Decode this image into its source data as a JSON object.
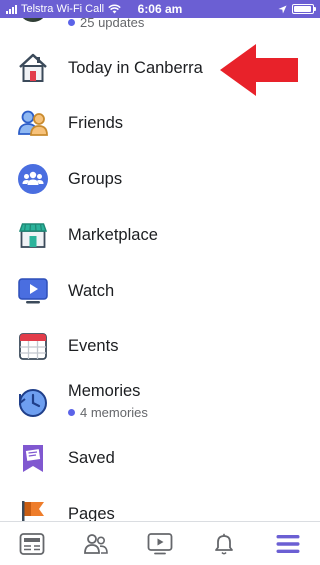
{
  "status_bar": {
    "carrier": "Telstra Wi-Fi Call",
    "time": "6:06 am",
    "battery_level": 0.95,
    "background_color": "#6b5fd3"
  },
  "partial_item": {
    "subtitle": "25 updates"
  },
  "menu": {
    "items": [
      {
        "label": "Today in Canberra",
        "icon": "house-icon"
      },
      {
        "label": "Friends",
        "icon": "friends-icon"
      },
      {
        "label": "Groups",
        "icon": "groups-icon"
      },
      {
        "label": "Marketplace",
        "icon": "marketplace-icon"
      },
      {
        "label": "Watch",
        "icon": "watch-icon"
      },
      {
        "label": "Events",
        "icon": "calendar-icon"
      },
      {
        "label": "Memories",
        "icon": "memories-clock-icon",
        "subtitle": "4 memories"
      },
      {
        "label": "Saved",
        "icon": "saved-icon"
      },
      {
        "label": "Pages",
        "icon": "flag-icon"
      }
    ]
  },
  "annotation": {
    "arrow_color": "#e8222a",
    "icon": "red-arrow-icon"
  },
  "tab_bar": {
    "tabs": [
      {
        "icon": "news-feed-icon",
        "active": false
      },
      {
        "icon": "friends-tab-icon",
        "active": false
      },
      {
        "icon": "watch-tab-icon",
        "active": false
      },
      {
        "icon": "notifications-bell-icon",
        "active": false
      },
      {
        "icon": "menu-hamburger-icon",
        "active": true
      }
    ],
    "active_color": "#6b5fd3",
    "inactive_color": "#65676b"
  }
}
